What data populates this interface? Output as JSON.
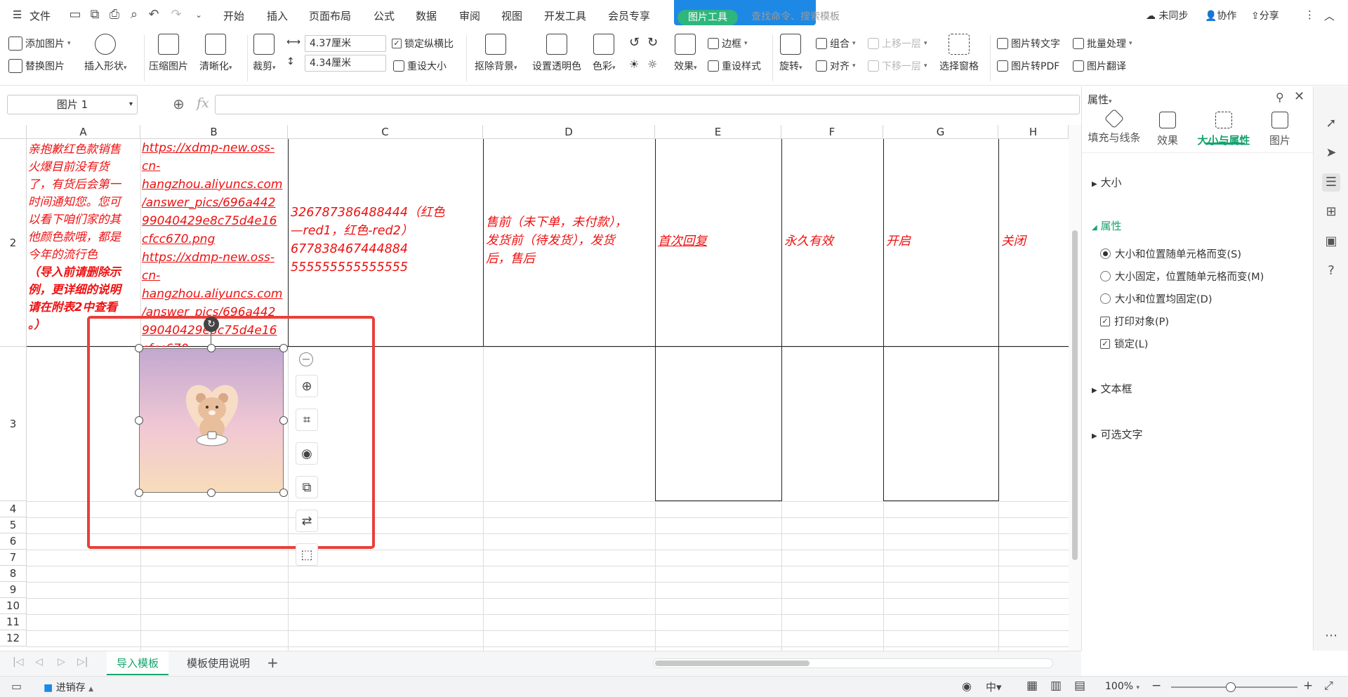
{
  "menubar": {
    "menu_label": "文件",
    "tabs": [
      "开始",
      "插入",
      "页面布局",
      "公式",
      "数据",
      "审阅",
      "视图",
      "开发工具",
      "会员专享"
    ],
    "context_tab": "图片工具",
    "search_placeholder": "查找命令、搜索模板",
    "sync": "未同步",
    "collab": "协作",
    "share": "分享"
  },
  "ribbon": {
    "add_picture": "添加图片",
    "replace_picture": "替换图片",
    "insert_shape": "插入形状",
    "compress": "压缩图片",
    "clarify": "清晰化",
    "crop": "裁剪",
    "width": "4.37厘米",
    "height": "4.34厘米",
    "lock_ratio": "锁定纵横比",
    "reset_size": "重设大小",
    "remove_bg": "抠除背景",
    "set_transparent": "设置透明色",
    "color": "色彩",
    "effects": "效果",
    "border": "边框",
    "reset_style": "重设样式",
    "rotate": "旋转",
    "group": "组合",
    "align": "对齐",
    "bring_forward": "上移一层",
    "send_backward": "下移一层",
    "selection_pane": "选择窗格",
    "pic_to_text": "图片转文字",
    "pic_to_pdf": "图片转PDF",
    "batch": "批量处理",
    "pic_translate": "图片翻译"
  },
  "formula": {
    "name_box": "图片 1",
    "fx": "fx",
    "value": ""
  },
  "grid": {
    "columns": [
      "A",
      "B",
      "C",
      "D",
      "E",
      "F",
      "G",
      "H"
    ],
    "rows": [
      "2",
      "3",
      "4",
      "5",
      "6",
      "7",
      "8",
      "9",
      "10",
      "11",
      "12"
    ],
    "cells": {
      "a2_lines": [
        "亲抱歉红色款销售",
        "火爆目前没有货",
        "了，有货后会第一",
        "时间通知您。您可",
        "以看下咱们家的其",
        "他颜色款哦，都是",
        "今年的流行色"
      ],
      "a2_bold_lines": [
        "（导入前请删除示",
        "例，更详细的说明",
        "请在附表2中查看",
        "。）"
      ],
      "b2_lines": [
        "https://xdmp-new.oss-",
        "cn-",
        "hangzhou.aliyuncs.com",
        "/answer_pics/696a442",
        "99040429e8c75d4e16",
        "cfcc670.png",
        "https://xdmp-new.oss-",
        "cn-",
        "hangzhou.aliyuncs.com",
        "/answer_pics/696a442",
        "99040429e8c75d4e16",
        "cfcc670"
      ],
      "c2_lines": [
        "326787386488444（红色",
        "—red1，红色-red2）",
        "677838467444884",
        "555555555555555"
      ],
      "d2_lines": [
        "售前（未下单，未付款），",
        "发货前（待发货），发货",
        "后，售后"
      ],
      "e2": "首次回复",
      "f2": "永久有效",
      "g2": "开启",
      "h2": "关闭"
    }
  },
  "panel": {
    "title": "属性",
    "tabs": [
      "填充与线条",
      "效果",
      "大小与属性",
      "图片"
    ],
    "active_tab": "大小与属性",
    "sections": {
      "size": "大小",
      "props": "属性",
      "textbox": "文本框",
      "alt_text": "可选文字"
    },
    "options": {
      "r1": "大小和位置随单元格而变(S)",
      "r2": "大小固定，位置随单元格而变(M)",
      "r3": "大小和位置均固定(D)",
      "c1": "打印对象(P)",
      "c2": "锁定(L)"
    }
  },
  "sheets": {
    "tabs": [
      "导入模板",
      "模板使用说明"
    ],
    "active": "导入模板"
  },
  "status": {
    "save_state": "进销存",
    "zoom": "100%"
  },
  "colors": {
    "accent": "#1e88e5",
    "green": "#2eb67d",
    "red_text": "#ee1111",
    "highlight": "#e8403a"
  }
}
